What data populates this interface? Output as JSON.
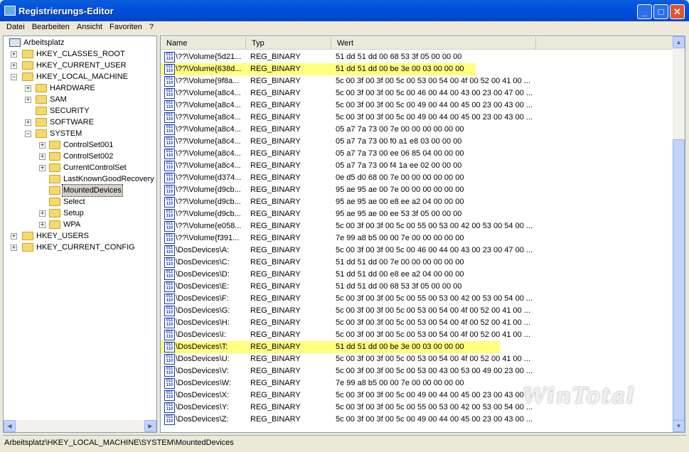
{
  "window": {
    "title": "Registrierungs-Editor",
    "min": "_",
    "max": "□",
    "close": "✕"
  },
  "menu": [
    "Datei",
    "Bearbeiten",
    "Ansicht",
    "Favoriten",
    "?"
  ],
  "tree": [
    {
      "label": "Arbeitsplatz",
      "level": 0,
      "exp": ""
    },
    {
      "label": "HKEY_CLASSES_ROOT",
      "level": 1,
      "exp": "+"
    },
    {
      "label": "HKEY_CURRENT_USER",
      "level": 1,
      "exp": "+"
    },
    {
      "label": "HKEY_LOCAL_MACHINE",
      "level": 1,
      "exp": "-"
    },
    {
      "label": "HARDWARE",
      "level": 2,
      "exp": "+"
    },
    {
      "label": "SAM",
      "level": 2,
      "exp": "+"
    },
    {
      "label": "SECURITY",
      "level": 2,
      "exp": ""
    },
    {
      "label": "SOFTWARE",
      "level": 2,
      "exp": "+"
    },
    {
      "label": "SYSTEM",
      "level": 2,
      "exp": "-"
    },
    {
      "label": "ControlSet001",
      "level": 3,
      "exp": "+"
    },
    {
      "label": "ControlSet002",
      "level": 3,
      "exp": "+"
    },
    {
      "label": "CurrentControlSet",
      "level": 3,
      "exp": "+"
    },
    {
      "label": "LastKnownGoodRecovery",
      "level": 3,
      "exp": ""
    },
    {
      "label": "MountedDevices",
      "level": 3,
      "exp": "",
      "selected": true
    },
    {
      "label": "Select",
      "level": 3,
      "exp": ""
    },
    {
      "label": "Setup",
      "level": 3,
      "exp": "+"
    },
    {
      "label": "WPA",
      "level": 3,
      "exp": "+"
    },
    {
      "label": "HKEY_USERS",
      "level": 1,
      "exp": "+"
    },
    {
      "label": "HKEY_CURRENT_CONFIG",
      "level": 1,
      "exp": "+"
    }
  ],
  "columns": {
    "name": "Name",
    "type": "Typ",
    "value": "Wert"
  },
  "rows": [
    {
      "name": "\\??\\Volume{5d21...",
      "type": "REG_BINARY",
      "value": "51 dd 51 dd 00 68 53 3f 05 00 00 00"
    },
    {
      "name": "\\??\\Volume{638d...",
      "type": "REG_BINARY",
      "value": "51 dd 51 dd 00 be 3e 00 03 00 00 00",
      "highlight": true
    },
    {
      "name": "\\??\\Volume{9f8a...",
      "type": "REG_BINARY",
      "value": "5c 00 3f 00 3f 00 5c 00 53 00 54 00 4f 00 52 00 41 00 ..."
    },
    {
      "name": "\\??\\Volume{a8c4...",
      "type": "REG_BINARY",
      "value": "5c 00 3f 00 3f 00 5c 00 46 00 44 00 43 00 23 00 47 00 ..."
    },
    {
      "name": "\\??\\Volume{a8c4...",
      "type": "REG_BINARY",
      "value": "5c 00 3f 00 3f 00 5c 00 49 00 44 00 45 00 23 00 43 00 ..."
    },
    {
      "name": "\\??\\Volume{a8c4...",
      "type": "REG_BINARY",
      "value": "5c 00 3f 00 3f 00 5c 00 49 00 44 00 45 00 23 00 43 00 ..."
    },
    {
      "name": "\\??\\Volume{a8c4...",
      "type": "REG_BINARY",
      "value": "05 a7 7a 73 00 7e 00 00 00 00 00 00"
    },
    {
      "name": "\\??\\Volume{a8c4...",
      "type": "REG_BINARY",
      "value": "05 a7 7a 73 00 f0 a1 e8 03 00 00 00"
    },
    {
      "name": "\\??\\Volume{a8c4...",
      "type": "REG_BINARY",
      "value": "05 a7 7a 73 00 ee 06 85 04 00 00 00"
    },
    {
      "name": "\\??\\Volume{a8c4...",
      "type": "REG_BINARY",
      "value": "05 a7 7a 73 00 f4 1a ee 02 00 00 00"
    },
    {
      "name": "\\??\\Volume{d374...",
      "type": "REG_BINARY",
      "value": "0e d5 d0 68 00 7e 00 00 00 00 00 00"
    },
    {
      "name": "\\??\\Volume{d9cb...",
      "type": "REG_BINARY",
      "value": "95 ae 95 ae 00 7e 00 00 00 00 00 00"
    },
    {
      "name": "\\??\\Volume{d9cb...",
      "type": "REG_BINARY",
      "value": "95 ae 95 ae 00 e8 ee a2 04 00 00 00"
    },
    {
      "name": "\\??\\Volume{d9cb...",
      "type": "REG_BINARY",
      "value": "95 ae 95 ae 00 ee 53 3f 05 00 00 00"
    },
    {
      "name": "\\??\\Volume{e058...",
      "type": "REG_BINARY",
      "value": "5c 00 3f 00 3f 00 5c 00 55 00 53 00 42 00 53 00 54 00 ..."
    },
    {
      "name": "\\??\\Volume{f391...",
      "type": "REG_BINARY",
      "value": "7e 99 a8 b5 00 00 7e 00 00 00 00 00"
    },
    {
      "name": "\\DosDevices\\A:",
      "type": "REG_BINARY",
      "value": "5c 00 3f 00 3f 00 5c 00 46 00 44 00 43 00 23 00 47 00 ..."
    },
    {
      "name": "\\DosDevices\\C:",
      "type": "REG_BINARY",
      "value": "51 dd 51 dd 00 7e 00 00 00 00 00 00"
    },
    {
      "name": "\\DosDevices\\D:",
      "type": "REG_BINARY",
      "value": "51 dd 51 dd 00 e8 ee a2 04 00 00 00"
    },
    {
      "name": "\\DosDevices\\E:",
      "type": "REG_BINARY",
      "value": "51 dd 51 dd 00 68 53 3f 05 00 00 00"
    },
    {
      "name": "\\DosDevices\\F:",
      "type": "REG_BINARY",
      "value": "5c 00 3f 00 3f 00 5c 00 55 00 53 00 42 00 53 00 54 00 ..."
    },
    {
      "name": "\\DosDevices\\G:",
      "type": "REG_BINARY",
      "value": "5c 00 3f 00 3f 00 5c 00 53 00 54 00 4f 00 52 00 41 00 ..."
    },
    {
      "name": "\\DosDevices\\H:",
      "type": "REG_BINARY",
      "value": "5c 00 3f 00 3f 00 5c 00 53 00 54 00 4f 00 52 00 41 00 ..."
    },
    {
      "name": "\\DosDevices\\I:",
      "type": "REG_BINARY",
      "value": "5c 00 3f 00 3f 00 5c 00 53 00 54 00 4f 00 52 00 41 00 ..."
    },
    {
      "name": "\\DosDevices\\T:",
      "type": "REG_BINARY",
      "value": "51 dd 51 dd 00 be 3e 00 03 00 00 00",
      "highlight": true
    },
    {
      "name": "\\DosDevices\\U:",
      "type": "REG_BINARY",
      "value": "5c 00 3f 00 3f 00 5c 00 53 00 54 00 4f 00 52 00 41 00 ..."
    },
    {
      "name": "\\DosDevices\\V:",
      "type": "REG_BINARY",
      "value": "5c 00 3f 00 3f 00 5c 00 53 00 43 00 53 00 49 00 23 00 ..."
    },
    {
      "name": "\\DosDevices\\W:",
      "type": "REG_BINARY",
      "value": "7e 99 a8 b5 00 00 7e 00 00 00 00 00"
    },
    {
      "name": "\\DosDevices\\X:",
      "type": "REG_BINARY",
      "value": "5c 00 3f 00 3f 00 5c 00 49 00 44 00 45 00 23 00 43 00 ..."
    },
    {
      "name": "\\DosDevices\\Y:",
      "type": "REG_BINARY",
      "value": "5c 00 3f 00 3f 00 5c 00 55 00 53 00 42 00 53 00 54 00 ..."
    },
    {
      "name": "\\DosDevices\\Z:",
      "type": "REG_BINARY",
      "value": "5c 00 3f 00 3f 00 5c 00 49 00 44 00 45 00 23 00 43 00 ..."
    }
  ],
  "status": "Arbeitsplatz\\HKEY_LOCAL_MACHINE\\SYSTEM\\MountedDevices",
  "watermark": "WinTotal",
  "colors": {
    "highlight": "#ffff80",
    "titlebar": "#0050e0"
  }
}
